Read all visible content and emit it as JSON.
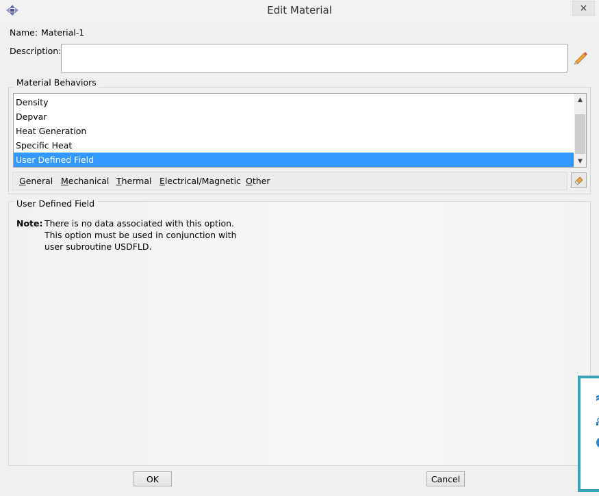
{
  "window": {
    "title": "Edit Material",
    "close_label": "×"
  },
  "name": {
    "label": "Name:",
    "value": "Material-1"
  },
  "description": {
    "label": "Description:",
    "value": ""
  },
  "behaviors": {
    "legend": "Material Behaviors",
    "items": [
      {
        "label": "Density",
        "selected": false
      },
      {
        "label": "Depvar",
        "selected": false
      },
      {
        "label": "Heat Generation",
        "selected": false
      },
      {
        "label": "Specific Heat",
        "selected": false
      },
      {
        "label": "User Defined Field",
        "selected": true
      }
    ],
    "menus": [
      {
        "mnemonic": "G",
        "rest": "eneral"
      },
      {
        "mnemonic": "M",
        "rest": "echanical"
      },
      {
        "mnemonic": "T",
        "rest": "hermal"
      },
      {
        "mnemonic": "E",
        "rest": "lectrical/Magnetic"
      },
      {
        "mnemonic": "O",
        "rest": "ther"
      }
    ]
  },
  "detail": {
    "legend": "User Defined Field",
    "note_label": "Note:",
    "note_lines": [
      "There is no data associated with this option.",
      "This option must be used in conjunction with",
      "user subroutine USDFLD."
    ]
  },
  "buttons": {
    "ok": "OK",
    "cancel": "Cancel"
  },
  "colors": {
    "selection": "#3399ff",
    "overlay_border": "#3aa1b6"
  },
  "icons": [
    "app-icon",
    "pencil-icon",
    "eraser-icon",
    "scroll-up-icon",
    "scroll-down-icon"
  ]
}
